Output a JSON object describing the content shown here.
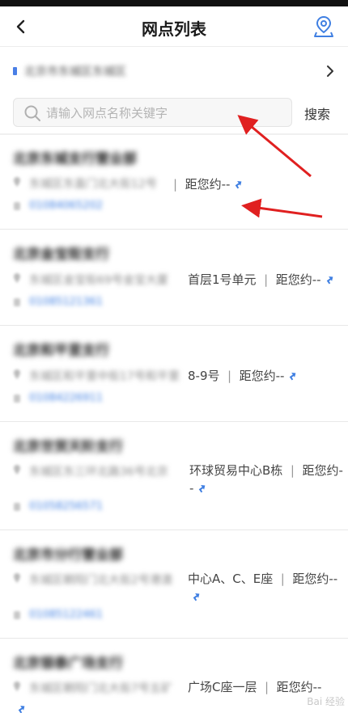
{
  "header": {
    "title": "网点列表"
  },
  "region": {
    "text": "北京市东城区东城区"
  },
  "search": {
    "placeholder": "请输入网点名称关键字",
    "button_label": "搜索"
  },
  "branches": [
    {
      "name": "北京东城支行营业部",
      "address_blurred": "东城区东直门北大街12号",
      "address_visible": "",
      "distance": "距您约--",
      "phone": "01084065202"
    },
    {
      "name": "北京金宝街支行",
      "address_blurred": "东城区金宝街69号金宝大厦",
      "address_visible": "首层1号单元",
      "distance": "距您约--",
      "phone": "01085121361"
    },
    {
      "name": "北京和平里支行",
      "address_blurred": "东城区和平里中街17号和平里",
      "address_visible": "8-9号",
      "distance": "距您约--",
      "phone": "01084226911"
    },
    {
      "name": "北京世贸天阶支行",
      "address_blurred": "东城区东三环北路36号北京",
      "address_visible": "环球贸易中心B栋",
      "distance": "距您约--",
      "phone": "01058256571"
    },
    {
      "name": "北京市分行营业部",
      "address_blurred": "东城区朝阳门北大街2号港澳",
      "address_visible": "中心A、C、E座",
      "distance": "距您约--",
      "phone": "01085122461"
    },
    {
      "name": "北京银泰广场支行",
      "address_blurred": "东城区朝阳门北大街7号五矿",
      "address_visible": "广场C座一层",
      "distance": "距您约--",
      "phone": "01065188831"
    }
  ],
  "colors": {
    "accent": "#3f7fe2",
    "annotation_arrow": "#e02020"
  },
  "icons": {
    "back": "chevron-left",
    "map": "map-pin-outline",
    "search": "magnifier",
    "region_next": "chevron-right",
    "navigate": "turn-arrow"
  },
  "watermark": {
    "text": "Bai 经验"
  }
}
